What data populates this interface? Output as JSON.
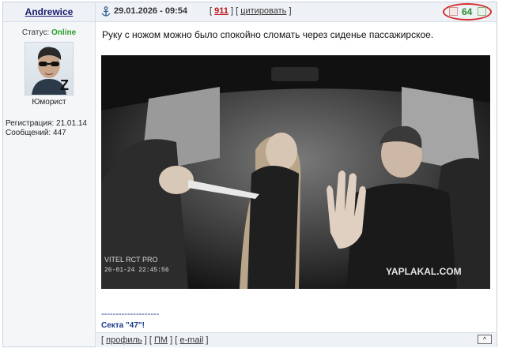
{
  "user": {
    "name": "Andrewice",
    "status_label": "Статус:",
    "status_value": "Online",
    "rank": "Юморист",
    "reg_label": "Регистрация:",
    "reg_date": "21.01.14",
    "posts_label": "Сообщений:",
    "posts_count": "447"
  },
  "post": {
    "datetime": "29.01.2026 - 09:54",
    "bracket_open": "[",
    "bracket_close": "]",
    "number": "911",
    "quote_label": "цитировать",
    "rating": "64",
    "text": "Руку с ножом можно было спокойно сломать через сиденье пассажирское.",
    "image": {
      "watermark": "YAPLAKAL.COM",
      "cam_brand": "VITEL RCT PRO",
      "cam_date": "26-01-24 22:45:56"
    },
    "signature_line": "--------------------",
    "signature": "Секта \"47\"!"
  },
  "footer": {
    "profile": "профиль",
    "pm": "ПМ",
    "email": "e-mail",
    "top": "^"
  },
  "colors": {
    "username": "#1a1a6e",
    "online": "#2a9d2a",
    "post_number": "#c0141a",
    "rating": "#2b8c2b",
    "rating_ring": "#d62c2c"
  }
}
